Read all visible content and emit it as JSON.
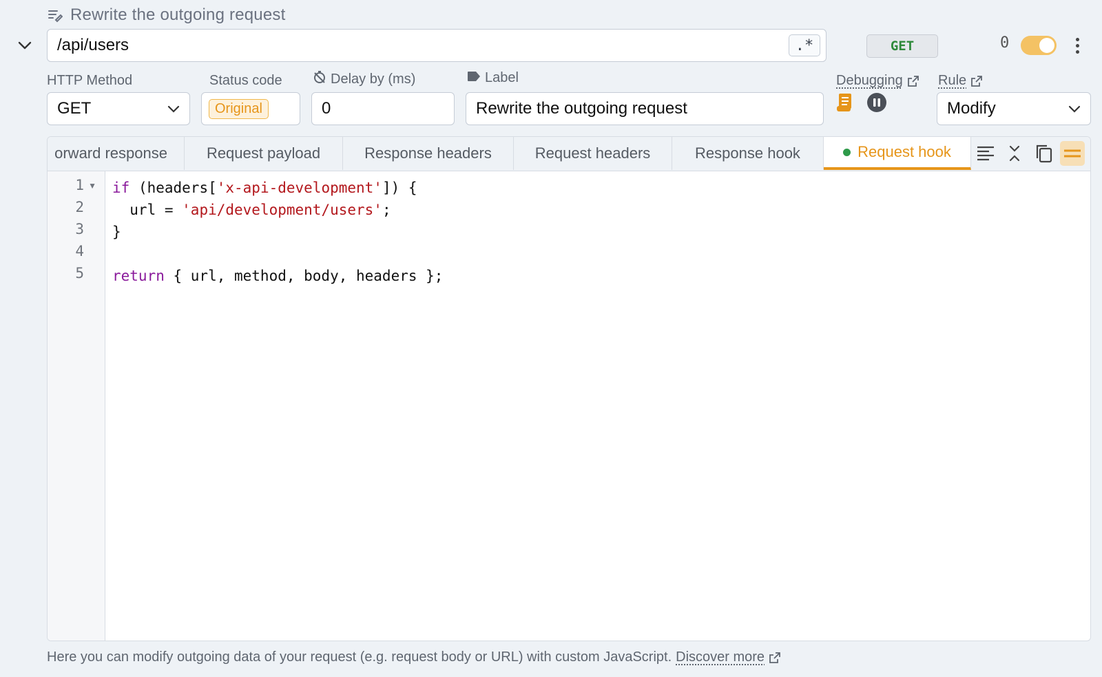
{
  "title": "Rewrite the outgoing request",
  "path": {
    "value": "/api/users",
    "regex_label": ".*"
  },
  "method_badge": "GET",
  "hit_count": "0",
  "toggle_on": true,
  "fields": {
    "http_method": {
      "label": "HTTP Method",
      "value": "GET"
    },
    "status_code": {
      "label": "Status code",
      "value": "Original"
    },
    "delay": {
      "label": "Delay by (ms)",
      "value": "0"
    },
    "label": {
      "label": "Label",
      "value": "Rewrite the outgoing request"
    },
    "debugging": {
      "label": "Debugging"
    },
    "rule": {
      "label": "Rule",
      "value": "Modify"
    }
  },
  "tabs": [
    {
      "label": "orward response",
      "active": false
    },
    {
      "label": "Request payload",
      "active": false
    },
    {
      "label": "Response headers",
      "active": false
    },
    {
      "label": "Request headers",
      "active": false
    },
    {
      "label": "Response hook",
      "active": false
    },
    {
      "label": "Request hook",
      "active": true
    }
  ],
  "editor": {
    "line_numbers": [
      "1",
      "2",
      "3",
      "4",
      "5"
    ]
  },
  "help": {
    "text": "Here you can modify outgoing data of your request (e.g. request body or URL) with custom JavaScript.",
    "link": "Discover more"
  },
  "colors": {
    "accent": "#e6951a",
    "active_dot": "#2e9a4a",
    "method_green": "#2f8a3b"
  }
}
